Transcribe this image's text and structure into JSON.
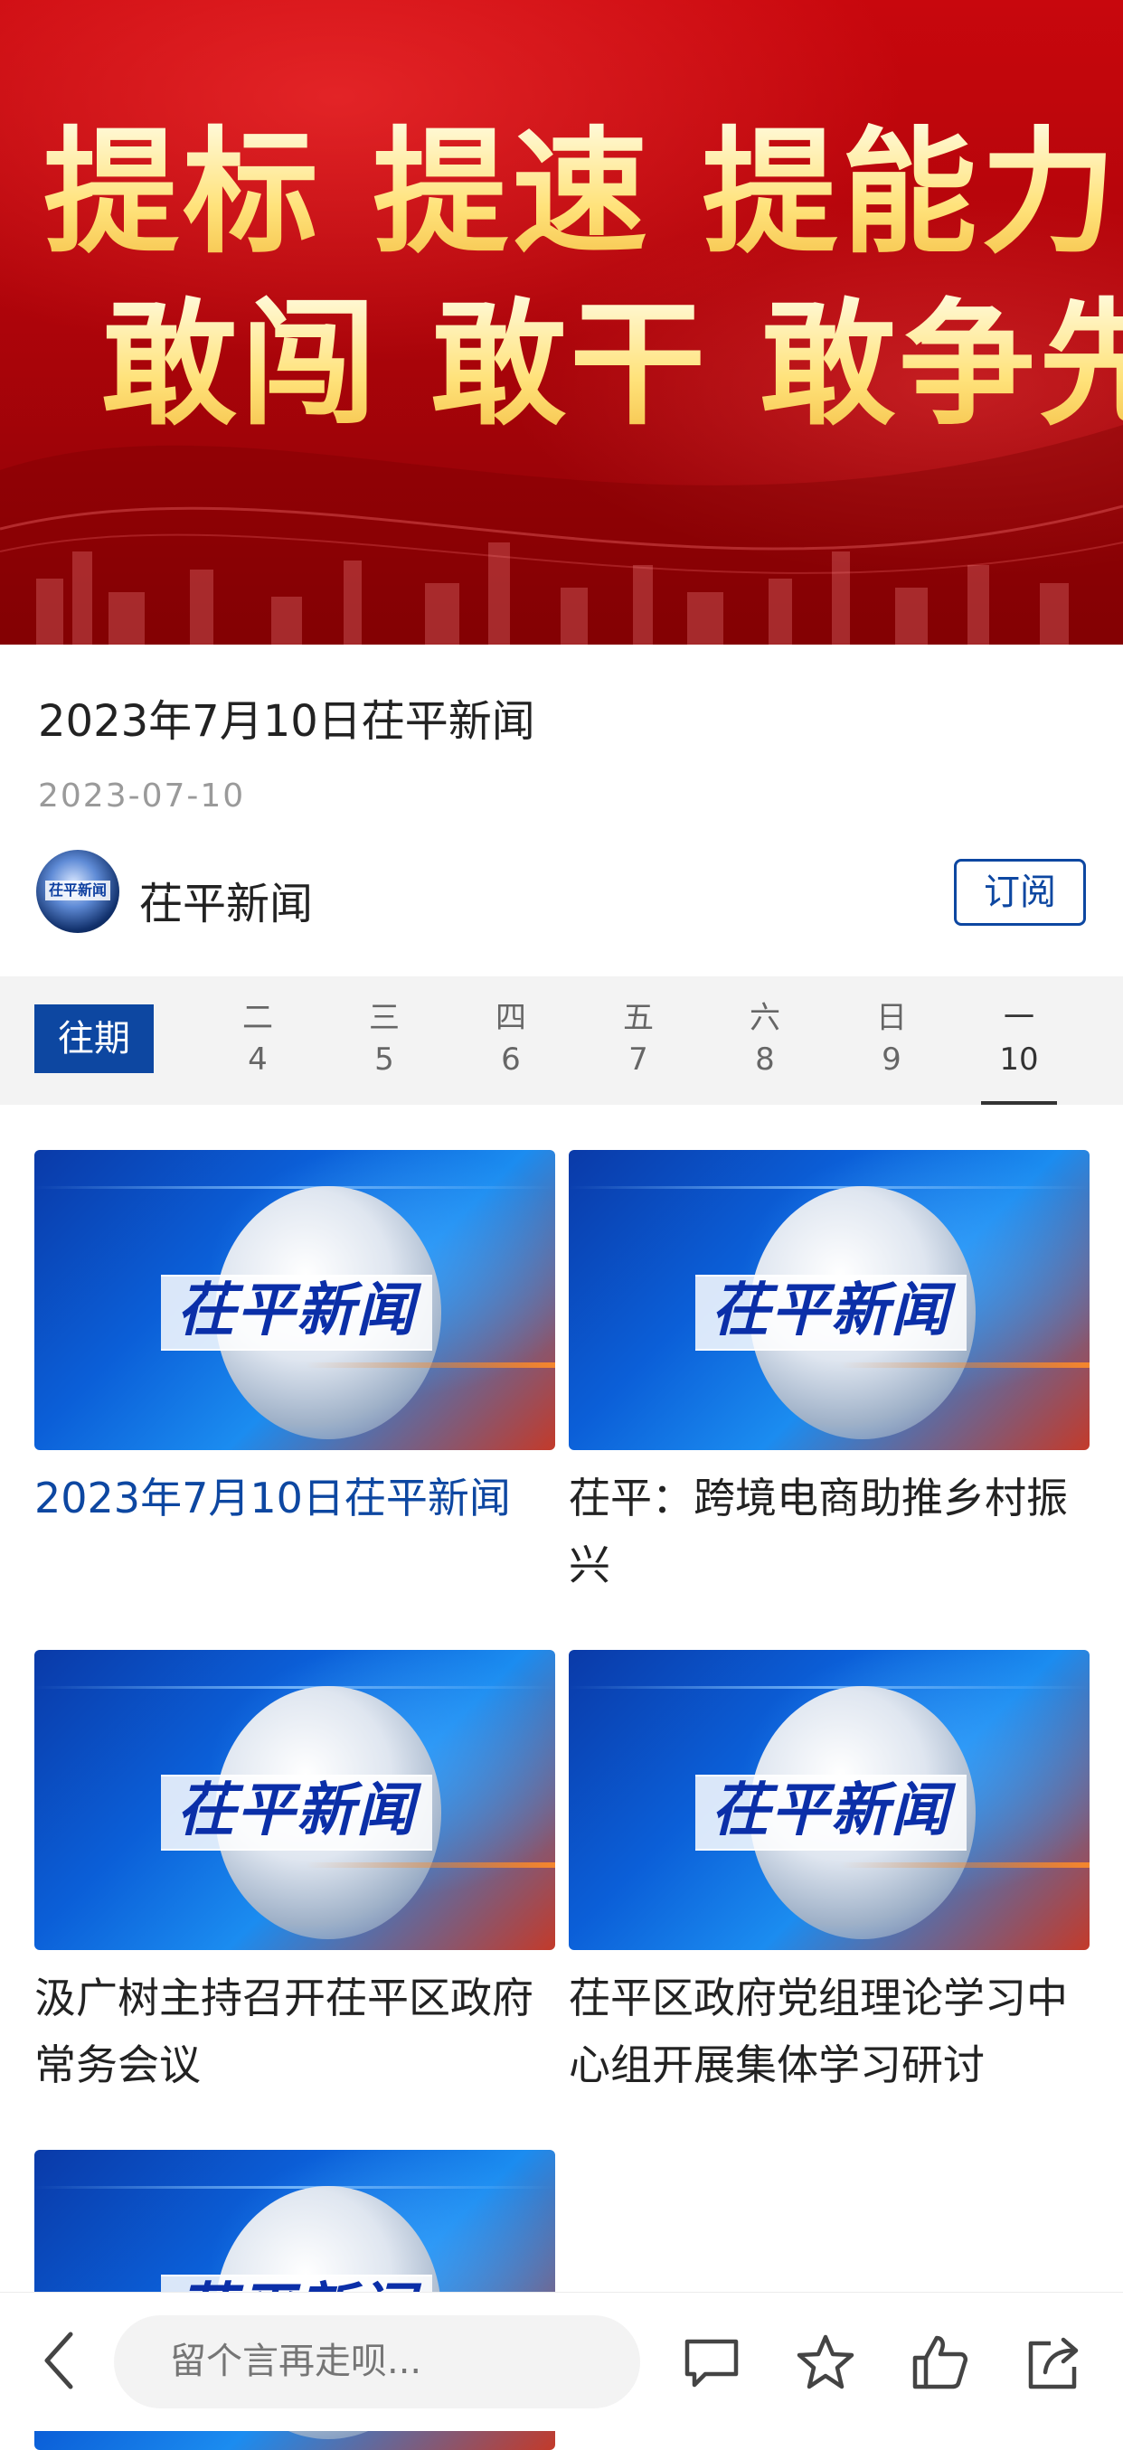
{
  "banner": {
    "line1": "提标 提速 提能力",
    "line2": "敢闯 敢干 敢争先"
  },
  "article": {
    "title": "2023年7月10日茌平新闻",
    "date": "2023-07-10"
  },
  "channel": {
    "name": "茌平新闻",
    "avatar_text": "茌平新闻",
    "subscribe_label": "订阅"
  },
  "date_strip": {
    "period_label": "往期",
    "days": [
      {
        "dow": "二",
        "num": "4"
      },
      {
        "dow": "三",
        "num": "5"
      },
      {
        "dow": "四",
        "num": "6"
      },
      {
        "dow": "五",
        "num": "7"
      },
      {
        "dow": "六",
        "num": "8"
      },
      {
        "dow": "日",
        "num": "9"
      },
      {
        "dow": "一",
        "num": "10"
      }
    ],
    "selected_index": 6
  },
  "thumbnail_logo_text": "茌平新闻",
  "cards": [
    {
      "title": "2023年7月10日茌平新闻",
      "active": true
    },
    {
      "title": "茌平：跨境电商助推乡村振兴",
      "active": false
    },
    {
      "title": "汲广树主持召开茌平区政府常务会议",
      "active": false
    },
    {
      "title": "茌平区政府党组理论学习中心组开展集体学习研讨",
      "active": false
    },
    {
      "title": "",
      "active": false
    }
  ],
  "bottom_bar": {
    "comment_placeholder": "留个言再走呗..."
  },
  "icons": [
    "back-icon",
    "comment-icon",
    "star-icon",
    "thumbs-up-icon",
    "share-icon"
  ],
  "colors": {
    "accent": "#0d47a1",
    "banner_red": "#c8070d",
    "banner_text": "#ffe27a"
  }
}
